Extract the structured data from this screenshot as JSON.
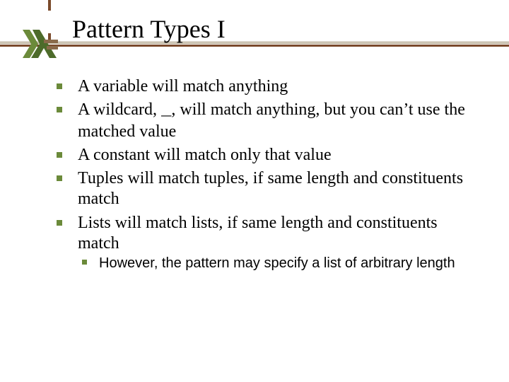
{
  "title": "Pattern Types I",
  "bullets": {
    "b1": "A variable will match anything",
    "b2_pre": "A wildcard, ",
    "b2_code": "_",
    "b2_post": ", will match anything, but you can’t use the matched value",
    "b3": "A constant will match only that value",
    "b4": "Tuples will match tuples, if same length and constituents match",
    "b5": "Lists will match lists, if same length and constituents match",
    "sub1": "However, the pattern may specify a list of arbitrary length"
  }
}
